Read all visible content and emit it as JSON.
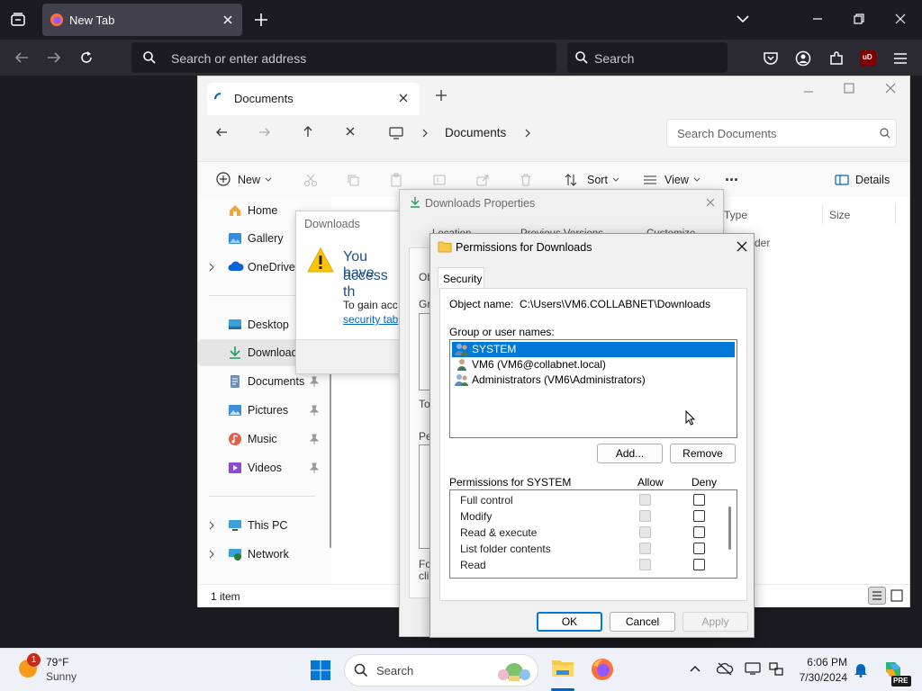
{
  "firefox": {
    "tab_title": "New Tab",
    "address_placeholder": "Search or enter address",
    "search_placeholder": "Search",
    "extension_badge": "uD"
  },
  "explorer": {
    "tab_title": "Documents",
    "breadcrumb": [
      "Documents"
    ],
    "search_placeholder": "Search Documents",
    "toolbar": {
      "new": "New",
      "sort": "Sort",
      "view": "View",
      "more": "...",
      "details": "Details"
    },
    "columns": {
      "type": "Type",
      "size": "Size",
      "folder_label": "der"
    },
    "nav": [
      {
        "label": "Home"
      },
      {
        "label": "Gallery"
      },
      {
        "label": "OneDrive"
      },
      {
        "label": "Desktop"
      },
      {
        "label": "Download"
      },
      {
        "label": "Documents"
      },
      {
        "label": "Pictures"
      },
      {
        "label": "Music"
      },
      {
        "label": "Videos"
      },
      {
        "label": "This PC"
      },
      {
        "label": "Network"
      }
    ],
    "status": "1 item"
  },
  "downloads_warning": {
    "title": "Downloads",
    "heading_line1": "You have",
    "heading_line2": "access th",
    "body": "To gain acc",
    "link": "security tab"
  },
  "downloads_properties": {
    "title": "Downloads Properties",
    "tabs": [
      "Location",
      "Previous Versions",
      "Customize"
    ],
    "frag_ob": "Ob",
    "frag_gro": "Gro",
    "frag_to": "To",
    "frag_pe": "Pe",
    "frag_fo": "Fo",
    "frag_cli": "cli"
  },
  "permissions": {
    "title": "Permissions for Downloads",
    "tab": "Security",
    "object_label": "Object name:",
    "object_value": "C:\\Users\\VM6.COLLABNET\\Downloads",
    "group_label": "Group or user names:",
    "users": [
      "SYSTEM",
      "VM6 (VM6@collabnet.local)",
      "Administrators (VM6\\Administrators)"
    ],
    "add_button": "Add...",
    "remove_button": "Remove",
    "perms_label": "Permissions for SYSTEM",
    "allow_header": "Allow",
    "deny_header": "Deny",
    "perms": [
      "Full control",
      "Modify",
      "Read & execute",
      "List folder contents",
      "Read"
    ],
    "ok": "OK",
    "cancel": "Cancel",
    "apply": "Apply"
  },
  "taskbar": {
    "weather_temp": "79°F",
    "weather_desc": "Sunny",
    "weather_badge": "1",
    "search_placeholder": "Search",
    "time": "6:06 PM",
    "date": "7/30/2024",
    "copilot_badge": "PRE"
  }
}
